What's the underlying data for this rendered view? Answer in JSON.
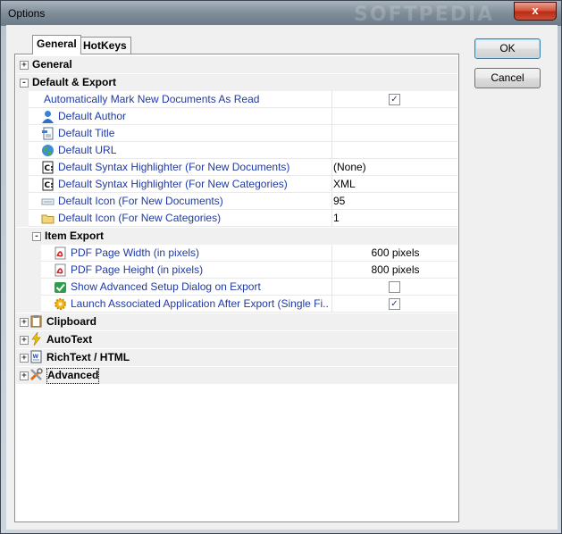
{
  "window": {
    "title": "Options",
    "watermark": "SOFTPEDIA",
    "close_glyph": "x"
  },
  "tabs": [
    {
      "label": "General"
    },
    {
      "label": "HotKeys"
    }
  ],
  "buttons": {
    "ok": "OK",
    "cancel": "Cancel"
  },
  "grid": {
    "categories": {
      "general": "General",
      "default_export": "Default & Export",
      "item_export": "Item Export",
      "clipboard": "Clipboard",
      "autotext": "AutoText",
      "richtext": "RichText / HTML",
      "advanced": "Advanced"
    },
    "expand_glyph": "+",
    "collapse_glyph": "-",
    "props": [
      {
        "name": "Automatically Mark New Documents As Read",
        "value": "",
        "checked": true,
        "icon": "none"
      },
      {
        "name": "Default Author",
        "value": "",
        "icon": "user-icon"
      },
      {
        "name": "Default Title",
        "value": "",
        "icon": "document-title-icon"
      },
      {
        "name": "Default URL",
        "value": "",
        "icon": "globe-icon"
      },
      {
        "name": "Default Syntax Highlighter (For New Documents)",
        "value": "(None)",
        "icon": "code-file-icon"
      },
      {
        "name": "Default Syntax Highlighter (For New Categories)",
        "value": "XML",
        "icon": "code-file-icon"
      },
      {
        "name": "Default Icon (For New Documents)",
        "value": "95",
        "icon": "small-doc-icon"
      },
      {
        "name": "Default Icon (For New Categories)",
        "value": "1",
        "icon": "folder-icon"
      }
    ],
    "item_export_props": [
      {
        "name": "PDF Page Width (in pixels)",
        "value": "600 pixels",
        "icon": "pdf-icon"
      },
      {
        "name": "PDF Page Height (in pixels)",
        "value": "800 pixels",
        "icon": "pdf-icon"
      },
      {
        "name": "Show Advanced Setup Dialog on Export",
        "value": "",
        "checked": false,
        "icon": "check-badge-icon"
      },
      {
        "name": "Launch Associated Application After Export (Single Fi...",
        "value": "",
        "checked": true,
        "icon": "gear-icon"
      }
    ],
    "check_glyph": "✓"
  }
}
